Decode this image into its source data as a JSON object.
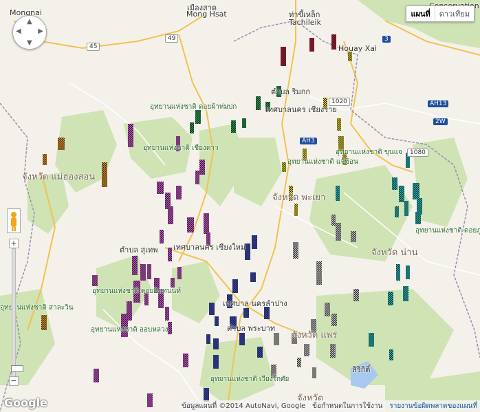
{
  "map_type_buttons": {
    "map": "แผนที่",
    "satellite": "ดาวเทียม"
  },
  "place_labels": [
    {
      "id": "mongnai",
      "text": "Mongnai",
      "cls": ""
    },
    {
      "id": "monghsat_th",
      "text": "เมืองสาด",
      "cls": ""
    },
    {
      "id": "monghsat",
      "text": "Mong Hsat",
      "cls": ""
    },
    {
      "id": "tachileik_th",
      "text": "ท่าขี้เหล็ก",
      "cls": ""
    },
    {
      "id": "tachileik",
      "text": "Tachileik",
      "cls": ""
    },
    {
      "id": "conservation",
      "text": "Conservation",
      "cls": ""
    },
    {
      "id": "houayxai",
      "text": "Houay Xai",
      "cls": ""
    },
    {
      "id": "rimkok",
      "text": "ตำบล ริมกก",
      "cls": ""
    },
    {
      "id": "chiangrai",
      "text": "เทศบาลนคร เชียงราย",
      "cls": ""
    },
    {
      "id": "doipha",
      "text": "อุทยานแห่งชาติ ดอยผ้าห่มปก",
      "cls": "park"
    },
    {
      "id": "chiangdao",
      "text": "อุทยานแห่งชาติ เชียงดาว",
      "cls": "park"
    },
    {
      "id": "khunchae",
      "text": "อุทยานแห่งชาติ ขุนแจ",
      "cls": "park"
    },
    {
      "id": "maehongson",
      "text": "จังหวัด แม่ฮ่องสอน",
      "cls": "prov"
    },
    {
      "id": "phayao",
      "text": "จังหวัด พะเยา",
      "cls": "prov"
    },
    {
      "id": "nan",
      "text": "จังหวัด น่าน",
      "cls": "prov"
    },
    {
      "id": "doiphukha",
      "text": "อุทยานแห่งชาติ ดอยภูคา",
      "cls": "park"
    },
    {
      "id": "suthep",
      "text": "ตำบล สุเทพ",
      "cls": ""
    },
    {
      "id": "chiangmai",
      "text": "เทศบาลนคร เชียงใหม่",
      "cls": ""
    },
    {
      "id": "doiinthanon",
      "text": "อุทยานแห่งชาติ ดอยอินทนนท์",
      "cls": "park"
    },
    {
      "id": "saloeng",
      "text": "อุทยานแห่งชาติ สาละวิน",
      "cls": "park"
    },
    {
      "id": "lampang",
      "text": "เทศบาล นครลำปาง",
      "cls": ""
    },
    {
      "id": "phrabat",
      "text": "ตำบล พระบาท",
      "cls": ""
    },
    {
      "id": "phrae",
      "text": "จังหวัด แพร่",
      "cls": "prov"
    },
    {
      "id": "obluang",
      "text": "อุทยานแห่งชาติ ออบหลวง",
      "cls": "park"
    },
    {
      "id": "sirikit",
      "text": "สิริกิติ์",
      "cls": ""
    },
    {
      "id": "chaeson",
      "text": "อุทยานแห่งชาติ แจ้ซ้อน",
      "cls": "park"
    },
    {
      "id": "chiangkhian",
      "text": "อุทยานแห่งชาติ เวียงโกศัย",
      "cls": "park"
    },
    {
      "id": "uttaradit",
      "text": "จังหวัด",
      "cls": "prov"
    }
  ],
  "road_shields": [
    {
      "id": "r45",
      "text": "45",
      "style": "white"
    },
    {
      "id": "r49",
      "text": "49",
      "style": "white"
    },
    {
      "id": "r3",
      "text": "3",
      "style": "blue"
    },
    {
      "id": "r1020",
      "text": "1020",
      "style": "white"
    },
    {
      "id": "ah13",
      "text": "AH13",
      "style": "blue"
    },
    {
      "id": "r2w",
      "text": "2W",
      "style": "blue"
    },
    {
      "id": "ah3",
      "text": "AH3",
      "style": "blue"
    },
    {
      "id": "r1080",
      "text": "1080",
      "style": "white"
    }
  ],
  "zoom": {
    "in": "+",
    "out": "−",
    "level": 0.95
  },
  "logo": "Google",
  "footer": {
    "data": "ข้อมูลแผนที่ ©2014 AutoNavi, Google",
    "terms": "ข้อกำหนดในการใช้งาน",
    "report": "รายงานข้อผิดพลาดของแผนที่"
  }
}
